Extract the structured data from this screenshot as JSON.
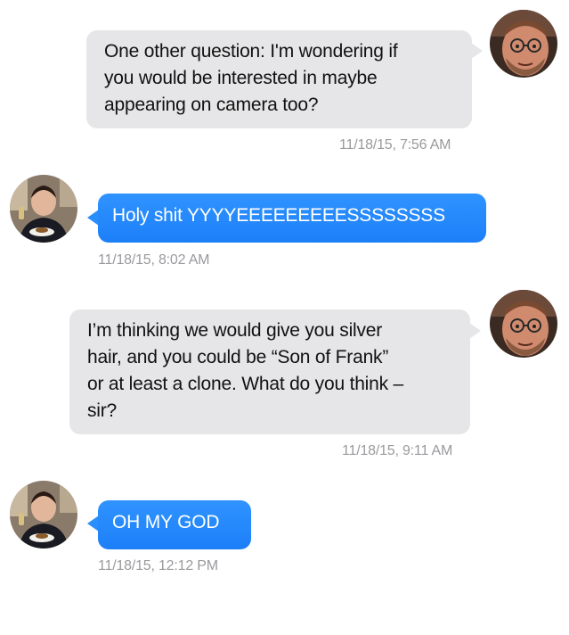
{
  "conversation": {
    "messages": [
      {
        "direction": "incoming",
        "sender_avatar": "bearded-man-glasses",
        "lines": [
          "One other question: I'm wondering if",
          "you would be interested in maybe",
          "appearing on camera too?"
        ],
        "timestamp": "11/18/15, 7:56 AM"
      },
      {
        "direction": "outgoing",
        "sender_avatar": "man-holding-plate",
        "lines": [
          "Holy shit YYYYEEEEEEEEESSSSSSSS"
        ],
        "timestamp": "11/18/15, 8:02 AM"
      },
      {
        "direction": "incoming",
        "sender_avatar": "bearded-man-glasses",
        "lines": [
          "I’m thinking we would give you silver",
          "hair, and you could be “Son of Frank”",
          "or at least a clone. What do you think –",
          "sir?"
        ],
        "timestamp": "11/18/15, 9:11 AM"
      },
      {
        "direction": "outgoing",
        "sender_avatar": "man-holding-plate",
        "lines": [
          "OH MY GOD"
        ],
        "timestamp": "11/18/15, 12:12 PM"
      }
    ]
  },
  "colors": {
    "incoming_bubble": "#e6e6e8",
    "outgoing_bubble": "#1d7ff8",
    "timestamp_text": "#9a9a9e"
  }
}
